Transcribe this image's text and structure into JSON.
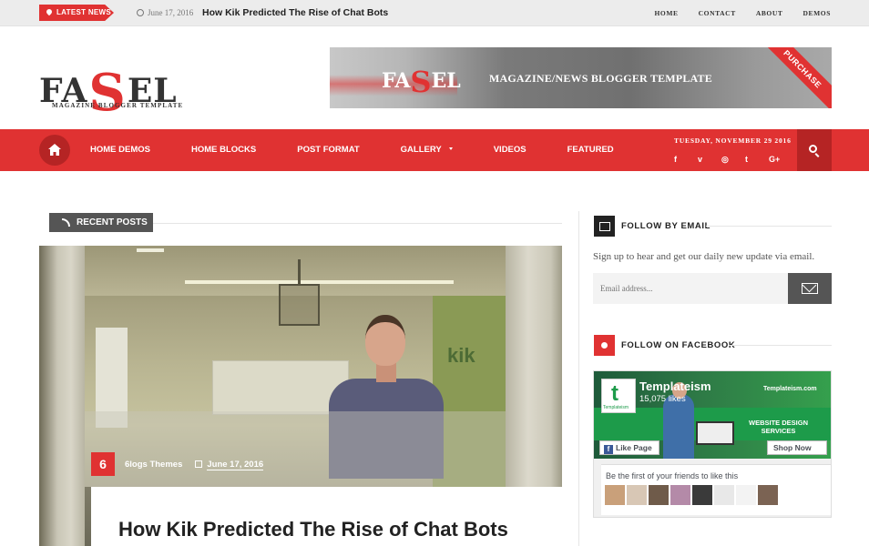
{
  "topbar": {
    "latest_badge": "LATEST NEWS",
    "ticker_date": "June 17, 2016",
    "ticker_title": "How Kik Predicted The Rise of Chat Bots",
    "links": [
      "HOME",
      "CONTACT",
      "ABOUT",
      "DEMOS"
    ]
  },
  "header": {
    "logo_prefix": "FA",
    "logo_s": "S",
    "logo_suffix": "EL",
    "logo_tagline": "MAGAZINE BLOGGER TEMPLATE",
    "banner_logo_prefix": "FA",
    "banner_logo_s": "S",
    "banner_logo_suffix": "EL",
    "banner_text": "MAGAZINE/NEWS BLOGGER TEMPLATE",
    "banner_ribbon": "PURCHASE"
  },
  "nav": {
    "items": [
      "HOME DEMOS",
      "HOME BLOCKS",
      "POST FORMAT",
      "GALLERY",
      "VIDEOS",
      "FEATURED"
    ],
    "date": "TUESDAY, NOVEMBER 29 2016",
    "social": [
      "f",
      "v",
      "◎",
      "t",
      "G+"
    ]
  },
  "main": {
    "section_title": "RECENT POSTS",
    "post": {
      "number": "6",
      "author": "6logs Themes",
      "date": "June 17, 2016",
      "title": "How Kik Predicted The Rise of Chat Bots",
      "image_text": "kik"
    }
  },
  "sidebar": {
    "email_widget": {
      "title": "FOLLOW BY EMAIL",
      "description": "Sign up to hear and get our daily new update via email.",
      "placeholder": "Email address..."
    },
    "facebook_widget": {
      "title": "FOLLOW ON FACEBOOK",
      "page_name": "Templateism",
      "likes": "15,075 likes",
      "site": "Templateism.com",
      "service_line1": "WEBSITE DESIGN",
      "service_line2": "SERVICES",
      "logo_mini": "Templateism",
      "like_button": "Like Page",
      "shop_button": "Shop Now",
      "friends_text": "Be the first of your friends to like this"
    }
  },
  "colors": {
    "accent": "#e03232",
    "accent_dark": "#b52424",
    "dark": "#222222"
  }
}
